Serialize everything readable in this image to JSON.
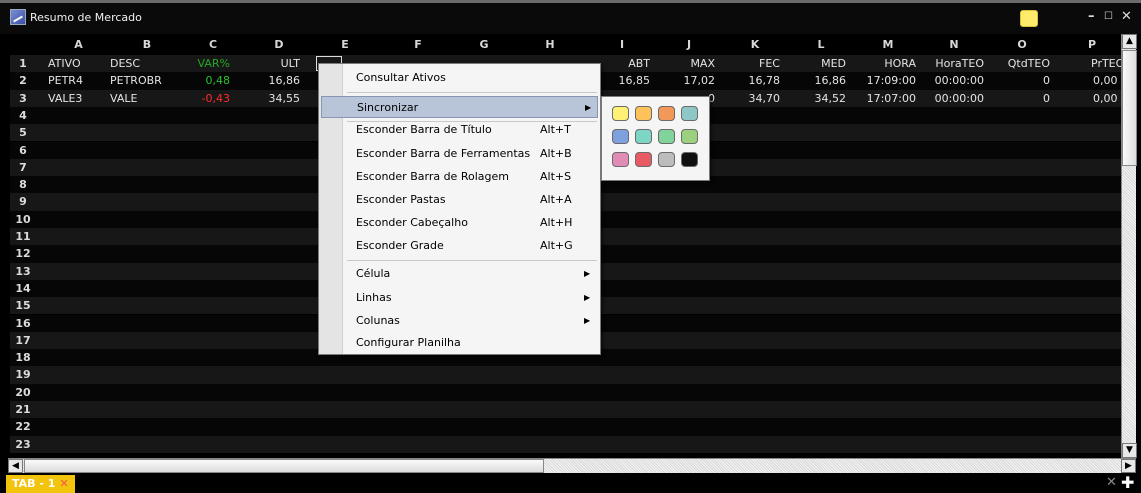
{
  "window": {
    "title": "Resumo de Mercado"
  },
  "columns": [
    "A",
    "B",
    "C",
    "D",
    "E",
    "F",
    "G",
    "H",
    "I",
    "J",
    "K",
    "L",
    "M",
    "N",
    "O",
    "P"
  ],
  "row_numbers": [
    "1",
    "2",
    "3",
    "4",
    "5",
    "6",
    "7",
    "8",
    "9",
    "10",
    "11",
    "12",
    "13",
    "14",
    "15",
    "16",
    "17",
    "18",
    "19",
    "20",
    "21",
    "22",
    "23"
  ],
  "header_row": {
    "ativo": "ATIVO",
    "desc": "DESC",
    "var": "VAR%",
    "ult": "ULT",
    "abt": "ABT",
    "max": "MAX",
    "fec": "FEC",
    "med": "MED",
    "hora": "HORA",
    "horateo": "HoraTEO",
    "qtdteo": "QtdTEO",
    "prteo": "PrTEO"
  },
  "rows": [
    {
      "ativo": "PETR4",
      "desc": "PETROBR",
      "var": "0,48",
      "ult": "16,86",
      "abt": "16,85",
      "max": "17,02",
      "fec": "16,78",
      "med": "16,86",
      "hora": "17:09:00",
      "horateo": "00:00:00",
      "qtdteo": "0",
      "prteo": "0,00"
    },
    {
      "ativo": "VALE3",
      "desc": "VALE",
      "var": "-0,43",
      "ult": "34,55",
      "abt": "",
      "max": "0",
      "fec": "34,70",
      "med": "34,52",
      "hora": "17:07:00",
      "horateo": "00:00:00",
      "qtdteo": "0",
      "prteo": "0,00"
    }
  ],
  "context_menu": {
    "consultar": "Consultar Ativos",
    "sincronizar": "Sincronizar",
    "items": [
      {
        "label": "Esconder Barra de Título",
        "shortcut": "Alt+T"
      },
      {
        "label": "Esconder Barra de Ferramentas",
        "shortcut": "Alt+B"
      },
      {
        "label": "Esconder Barra de Rolagem",
        "shortcut": "Alt+S"
      },
      {
        "label": "Esconder Pastas",
        "shortcut": "Alt+A"
      },
      {
        "label": "Esconder Cabeçalho",
        "shortcut": "Alt+H"
      },
      {
        "label": "Esconder Grade",
        "shortcut": "Alt+G"
      }
    ],
    "celula": "Célula",
    "linhas": "Linhas",
    "colunas": "Colunas",
    "configurar": "Configurar Planilha"
  },
  "sync_colors": [
    "#fff176",
    "#ffc15a",
    "#f2995a",
    "#8fc7c6",
    "#7fa0df",
    "#7dd6c4",
    "#7fd39b",
    "#9bd17e",
    "#e08cb4",
    "#e85a64",
    "#bcbcbc",
    "#101010"
  ],
  "tabs": [
    {
      "label": "TAB - 1"
    }
  ],
  "colors": {
    "positive": "#2ec02e",
    "negative": "#ff2a2a",
    "tab": "#f2c40c",
    "sticky": "#ffec6a"
  }
}
